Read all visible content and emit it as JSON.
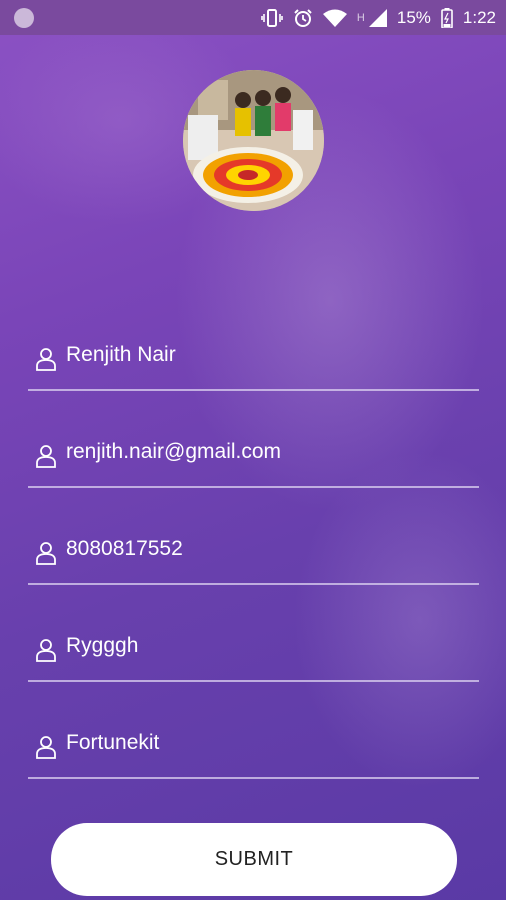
{
  "status_bar": {
    "battery_percent": "15%",
    "time": "1:22",
    "network_label": "H",
    "icons": [
      "notification-dot-icon",
      "vibrate-icon",
      "alarm-icon",
      "wifi-icon",
      "signal-icon",
      "battery-icon"
    ]
  },
  "profile": {
    "avatar_icon": "profile-photo"
  },
  "form": {
    "fields": [
      {
        "value": "Renjith Nair",
        "icon": "user-icon"
      },
      {
        "value": "renjith.nair@gmail.com",
        "icon": "user-icon"
      },
      {
        "value": "8080817552",
        "icon": "user-icon"
      },
      {
        "value": "Rygggh",
        "icon": "user-icon"
      },
      {
        "value": "Fortunekit",
        "icon": "user-icon"
      }
    ],
    "submit_label": "SUBMIT"
  },
  "colors": {
    "accent": "#7a45b8",
    "status_bar": "#7a4a9e",
    "button": "#ffffff"
  }
}
